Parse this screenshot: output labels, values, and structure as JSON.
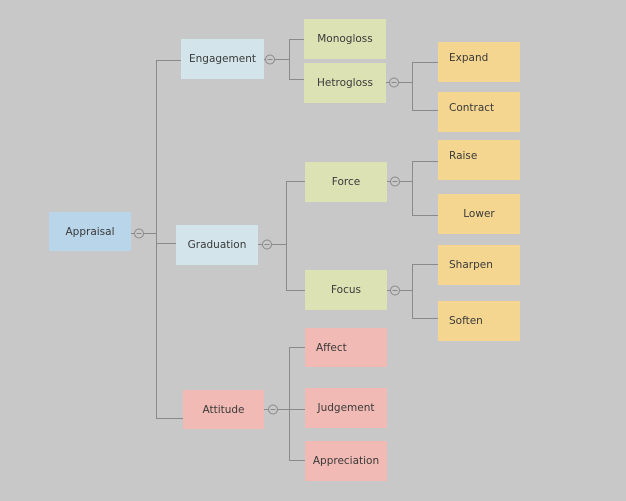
{
  "diagram": {
    "title": "Appraisal",
    "colors": {
      "background": "#c8c8c8",
      "root": "#b9d5ea",
      "category": "#d3e5ea",
      "subcategory_green": "#dce2b4",
      "attitude_red": "#f2bab4",
      "leaf_orange": "#f4d690",
      "line": "#8a8a8a"
    },
    "root": {
      "label": "Appraisal"
    },
    "branches": [
      {
        "label": "Engagement",
        "children": [
          {
            "label": "Monogloss",
            "children": []
          },
          {
            "label": "Hetrogloss",
            "children": [
              {
                "label": "Expand"
              },
              {
                "label": "Contract"
              }
            ]
          }
        ]
      },
      {
        "label": "Graduation",
        "children": [
          {
            "label": "Force",
            "children": [
              {
                "label": "Raise"
              },
              {
                "label": "Lower"
              }
            ]
          },
          {
            "label": "Focus",
            "children": [
              {
                "label": "Sharpen"
              },
              {
                "label": "Soften"
              }
            ]
          }
        ]
      },
      {
        "label": "Attitude",
        "children": [
          {
            "label": "Affect"
          },
          {
            "label": "Judgement"
          },
          {
            "label": "Appreciation"
          }
        ]
      }
    ]
  }
}
